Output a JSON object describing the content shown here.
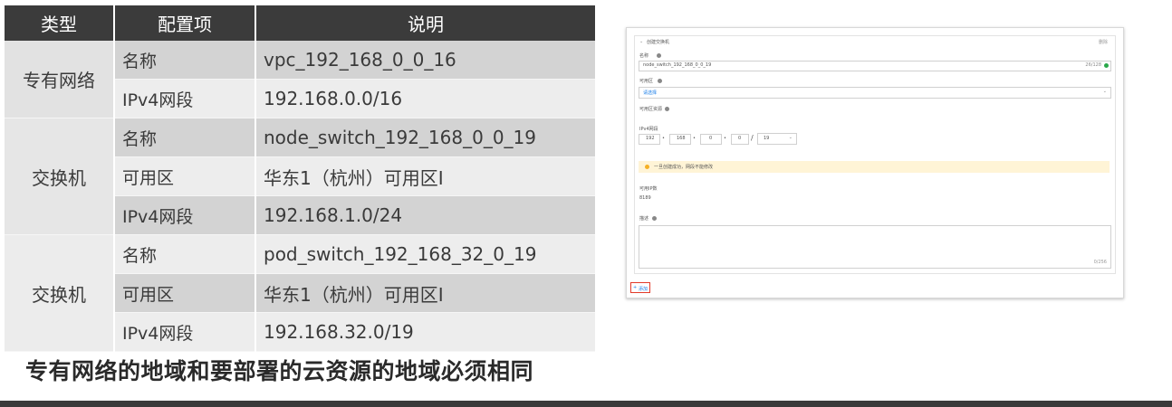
{
  "table": {
    "headers": [
      "类型",
      "配置项",
      "说明"
    ],
    "groups": [
      {
        "type": "专有网络",
        "rows": [
          {
            "item": "名称",
            "desc": "vpc_192_168_0_0_16"
          },
          {
            "item": "IPv4网段",
            "desc": "192.168.0.0/16"
          }
        ]
      },
      {
        "type": "交换机",
        "rows": [
          {
            "item": "名称",
            "desc": "node_switch_192_168_0_0_19"
          },
          {
            "item": "可用区",
            "desc": "华东1（杭州）可用区I"
          },
          {
            "item": "IPv4网段",
            "desc": "192.168.1.0/24"
          }
        ]
      },
      {
        "type": "交换机",
        "rows": [
          {
            "item": "名称",
            "desc": "pod_switch_192_168_32_0_19"
          },
          {
            "item": "可用区",
            "desc": "华东1（杭州）可用区I"
          },
          {
            "item": "IPv4网段",
            "desc": "192.168.32.0/19"
          }
        ]
      }
    ]
  },
  "caption": "专有网络的地域和要部署的云资源的地域必须相同",
  "form": {
    "section_title": "创建交换机",
    "delete_label": "删除",
    "name_label": "名称",
    "name_value": "node_switch_192_168_0_0_19",
    "name_count": "26/128",
    "zone_label": "可用区",
    "zone_value": "请选择",
    "zone_resource_label": "可用区资源",
    "ipv4_label": "IPv4网段",
    "ip_octets": [
      "192",
      "168",
      "0",
      "0"
    ],
    "ip_mask": "19",
    "ip_notice": "一旦创建成功，网段不能修改",
    "available_ip_label": "可用IP数",
    "available_ip_value": "8189",
    "desc_label": "描述",
    "desc_count": "0/256",
    "add_label": "添加",
    "accent_color": "#1a7ee8",
    "valid_color": "#2aa84a",
    "notice_color": "#f5b025",
    "highlight_color": "#e23a2a"
  }
}
